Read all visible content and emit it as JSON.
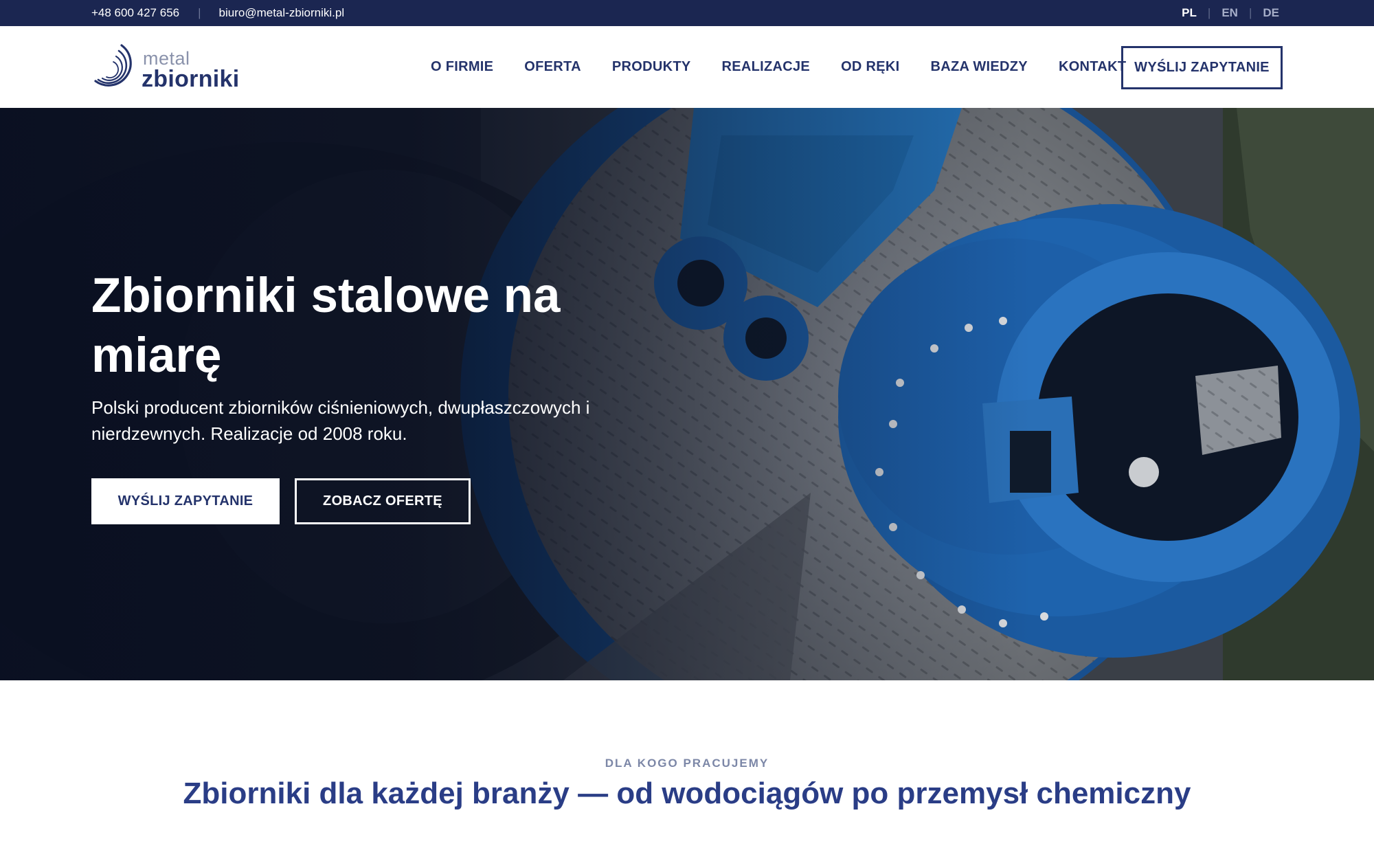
{
  "topbar": {
    "phone": "+48 600 427 656",
    "separator": "|",
    "email": "biuro@metal-zbiorniki.pl",
    "languages": [
      {
        "label": "PL",
        "active": true
      },
      {
        "label": "EN",
        "active": false
      },
      {
        "label": "DE",
        "active": false
      }
    ]
  },
  "logo": {
    "top": "metal",
    "bottom": "zbiorniki"
  },
  "nav": {
    "items": [
      "O FIRMIE",
      "OFERTA",
      "PRODUKTY",
      "REALIZACJE",
      "OD RĘKI",
      "BAZA WIEDZY",
      "KONTAKT"
    ],
    "cta": "WYŚLIJ ZAPYTANIE"
  },
  "hero": {
    "title": "Zbiorniki stalowe na miarę",
    "subtitle": "Polski producent zbiorników ciśnieniowych, dwupłaszczowych i nierdzewnych. Realizacje od 2008 roku.",
    "primary_button": "WYŚLIJ ZAPYTANIE",
    "secondary_button": "ZOBACZ OFERTĘ"
  },
  "section": {
    "eyebrow": "DLA KOGO PRACUJEMY",
    "title": "Zbiorniki dla każdej branży — od wodociągów po przemysł chemiczny"
  },
  "colors": {
    "topbar_bg": "#1b2651",
    "brand_navy": "#24336b",
    "heading_blue": "#2a3d86",
    "eyebrow_gray": "#7c87a7",
    "equipment_blue": "#1d5fa8"
  },
  "icons": {
    "logo_mark": "concentric-arcs-logo-icon"
  }
}
